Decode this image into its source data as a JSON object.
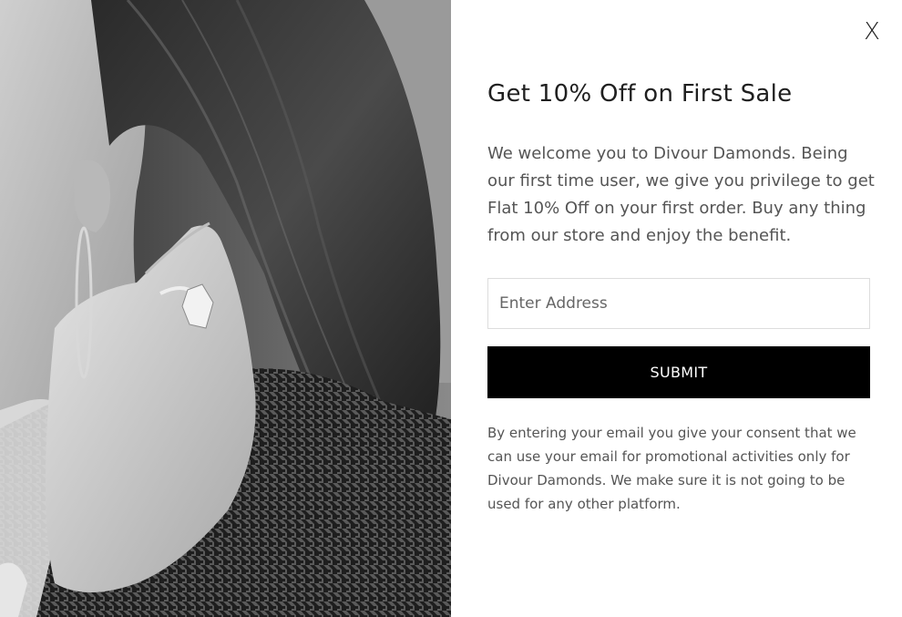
{
  "popup": {
    "close_label": "X",
    "title": "Get 10% Off on First Sale",
    "intro": "We welcome you to Divour Damonds. Being our first time user, we give you privilege to get Flat 10% Off on your first order. Buy any thing from our store and enjoy the benefit.",
    "address_placeholder": "Enter Address",
    "address_value": "",
    "submit_label": "SUBMIT",
    "consent": "By entering your email you give your consent that we can use your email for promotional activities only for Divour Damonds. We make sure it is not going to be used for any other platform."
  },
  "photo": {
    "subject": "black-and-white photo of woman with hoop earring and crystal ring touching her neck",
    "style": "grayscale"
  },
  "colors": {
    "button_bg": "#000000",
    "button_text": "#ffffff",
    "body_text": "#555555",
    "heading_text": "#1f1f1f",
    "input_border": "#dddddd"
  }
}
